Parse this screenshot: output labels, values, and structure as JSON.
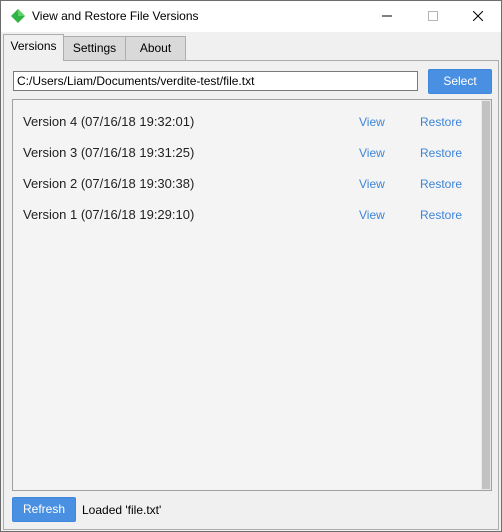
{
  "window": {
    "title": "View and Restore File Versions",
    "icon": "green-diamond-icon",
    "controls": [
      "minimize-icon",
      "maximize-icon",
      "close-icon"
    ]
  },
  "tabs": [
    {
      "label": "Versions",
      "active": true
    },
    {
      "label": "Settings",
      "active": false
    },
    {
      "label": "About",
      "active": false
    }
  ],
  "path": {
    "value": "C:/Users/Liam/Documents/verdite-test/file.txt",
    "select_label": "Select"
  },
  "versions": [
    {
      "label": "Version 4 (07/16/18 19:32:01)",
      "view": "View",
      "restore": "Restore"
    },
    {
      "label": "Version 3 (07/16/18 19:31:25)",
      "view": "View",
      "restore": "Restore"
    },
    {
      "label": "Version 2 (07/16/18 19:30:38)",
      "view": "View",
      "restore": "Restore"
    },
    {
      "label": "Version 1 (07/16/18 19:29:10)",
      "view": "View",
      "restore": "Restore"
    }
  ],
  "footer": {
    "refresh_label": "Refresh",
    "status": "Loaded 'file.txt'"
  },
  "colors": {
    "accent": "#4a90e2",
    "link": "#3d84d6",
    "app_icon": "#2fb344"
  }
}
